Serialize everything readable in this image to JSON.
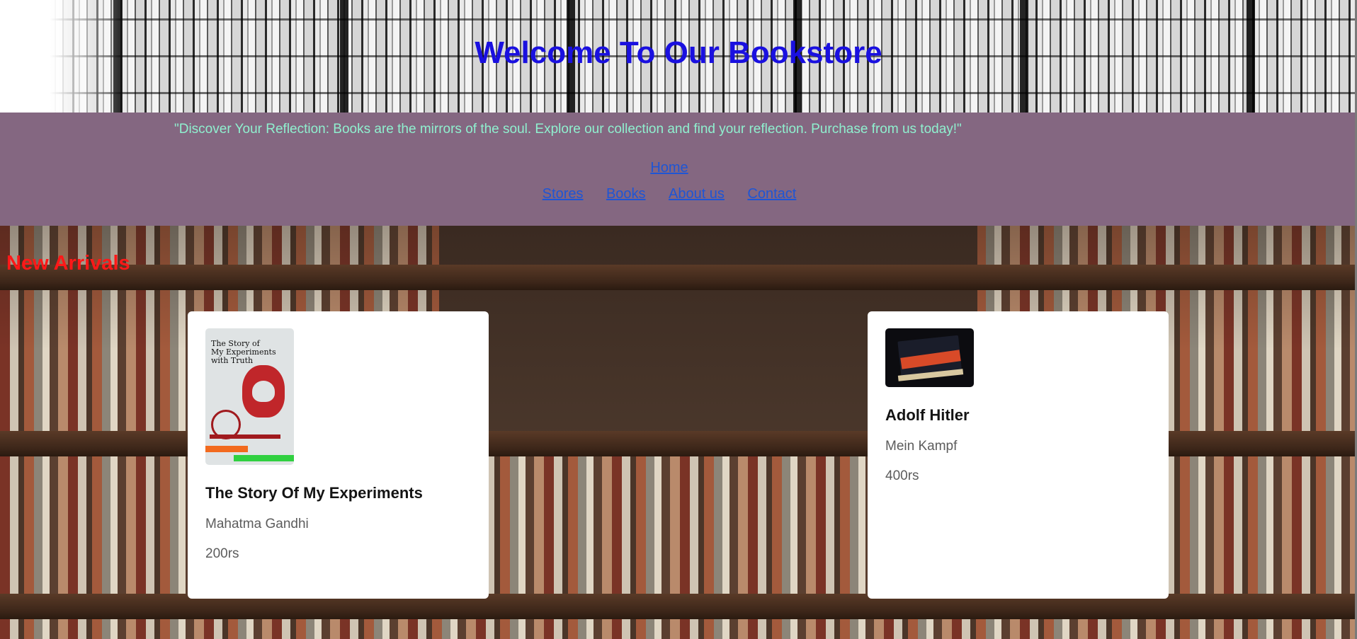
{
  "header": {
    "title": "Welcome To Our Bookstore"
  },
  "tagline": "\"Discover Your Reflection: Books are the mirrors of the soul. Explore our collection and find your reflection. Purchase from us today!\"",
  "nav": {
    "home": "Home",
    "links": [
      "Stores",
      "Books",
      "About us",
      "Contact"
    ]
  },
  "section": {
    "heading": "New Arrivals"
  },
  "books": [
    {
      "title": "The Story Of My Experiments",
      "author": "Mahatma Gandhi",
      "price": "200rs",
      "cover": {
        "line1": "The Story of",
        "line2": "My Experiments",
        "line3": "with Truth"
      }
    },
    {
      "title": "Adolf Hitler",
      "author": "Mein Kampf",
      "price": "400rs"
    }
  ],
  "colors": {
    "title": "#1a10e0",
    "tagline": "#8ff0cf",
    "band": "#846781",
    "link": "#1f55d4",
    "heading": "#ff1818"
  }
}
